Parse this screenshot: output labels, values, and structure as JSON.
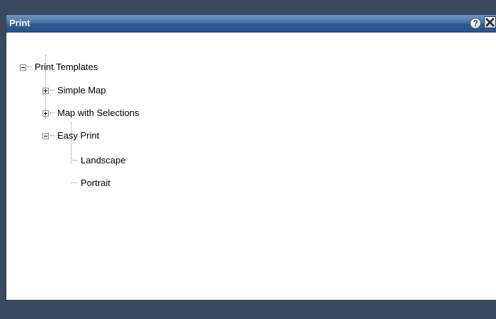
{
  "window": {
    "title": "Print",
    "help_glyph": "?",
    "help_icon": "help-icon",
    "close_icon": "close-icon"
  },
  "tree": {
    "root": {
      "label": "Print Templates",
      "expanded": true
    },
    "children": [
      {
        "label": "Simple Map",
        "expanded": false
      },
      {
        "label": "Map with Selections",
        "expanded": false
      },
      {
        "label": "Easy Print",
        "expanded": true
      }
    ],
    "easy_print_items": [
      {
        "label": "Landscape"
      },
      {
        "label": "Portrait"
      }
    ]
  },
  "colors": {
    "titlebar": "#2f5a91",
    "background": "#394a5e"
  }
}
